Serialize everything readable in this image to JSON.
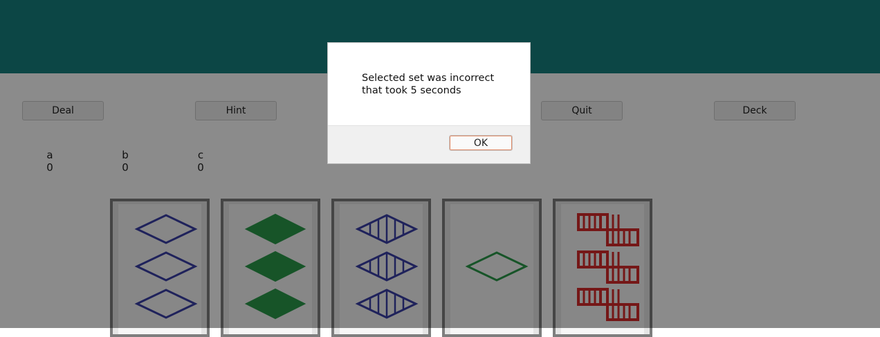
{
  "toolbar": {
    "deal_label": "Deal",
    "hint_label": "Hint",
    "quit_label": "Quit",
    "deck_label": "Deck"
  },
  "scores": [
    {
      "player": "a",
      "value": "0"
    },
    {
      "player": "b",
      "value": "0"
    },
    {
      "player": "c",
      "value": "0"
    }
  ],
  "cards": [
    {
      "count": 3,
      "shape": "diamond",
      "fill": "open",
      "color": "blue"
    },
    {
      "count": 3,
      "shape": "diamond",
      "fill": "solid",
      "color": "green"
    },
    {
      "count": 3,
      "shape": "diamond",
      "fill": "striped",
      "color": "blue"
    },
    {
      "count": 1,
      "shape": "diamond",
      "fill": "open",
      "color": "green"
    },
    {
      "count": 3,
      "shape": "squiggle",
      "fill": "striped",
      "color": "red"
    }
  ],
  "colors": {
    "header": "#16807f",
    "blue": "#3a3fa6",
    "green": "#2a9a4a",
    "red": "#d62b2b"
  },
  "dialog": {
    "line1": "Selected set was incorrect",
    "line2": "that took 5 seconds",
    "ok_label": "OK"
  }
}
